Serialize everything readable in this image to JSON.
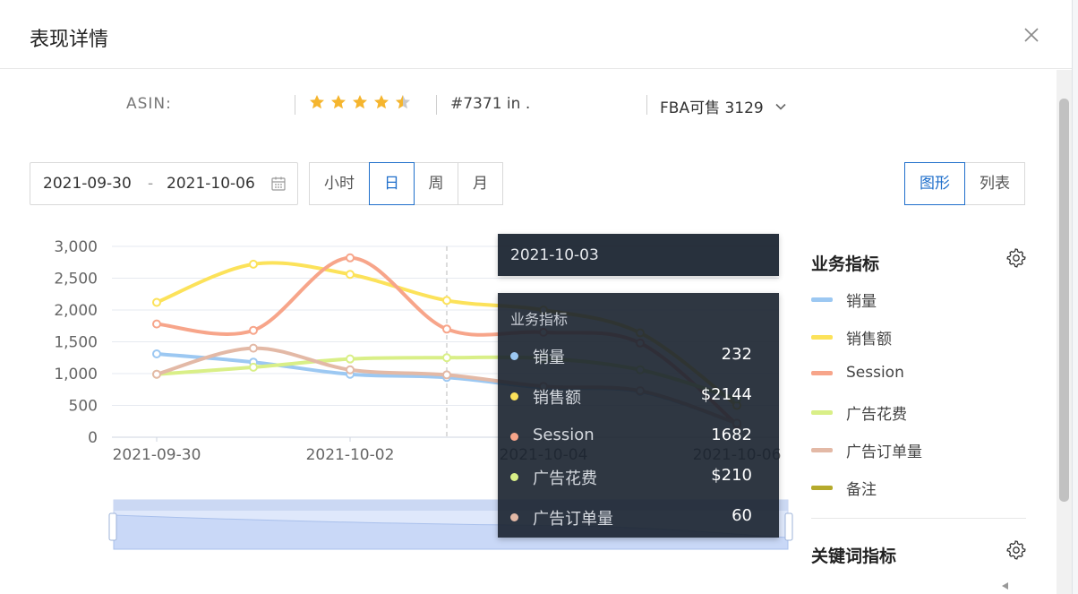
{
  "modal": {
    "title": "表现详情"
  },
  "info": {
    "asin_label": "ASIN:",
    "rating": 4.5,
    "rank_text": "#7371 in .",
    "fba_text": "FBA可售 3129"
  },
  "filters": {
    "start_date": "2021-09-30",
    "date_sep": "-",
    "end_date": "2021-10-06",
    "granularity": [
      "小时",
      "日",
      "周",
      "月"
    ],
    "granularity_selected": "日",
    "views": [
      "图形",
      "列表"
    ],
    "view_selected": "图形"
  },
  "legend": {
    "business_title": "业务指标",
    "keyword_title": "关键词指标",
    "items": [
      {
        "label": "销量",
        "color": "#9cc8f2"
      },
      {
        "label": "销售额",
        "color": "#fce25a"
      },
      {
        "label": "Session",
        "color": "#f7a58a"
      },
      {
        "label": "广告花费",
        "color": "#d9ef87"
      },
      {
        "label": "广告订单量",
        "color": "#e3b9a6"
      },
      {
        "label": "备注",
        "color": "#b5aa2c"
      }
    ]
  },
  "tooltip": {
    "date": "2021-10-03",
    "section": "业务指标",
    "rows": [
      {
        "name": "销量",
        "value": "232",
        "color": "#9cc8f2"
      },
      {
        "name": "销售额",
        "value": "$2144",
        "color": "#fce25a"
      },
      {
        "name": "Session",
        "value": "1682",
        "color": "#f7a58a"
      },
      {
        "name": "广告花费",
        "value": "$210",
        "color": "#d9ef87"
      },
      {
        "name": "广告订单量",
        "value": "60",
        "color": "#e3b9a6"
      }
    ]
  },
  "chart_data": {
    "type": "line",
    "x": [
      "2021-09-30",
      "2021-10-01",
      "2021-10-02",
      "2021-10-03",
      "2021-10-04",
      "2021-10-05",
      "2021-10-06"
    ],
    "x_tick_labels": [
      "2021-09-30",
      "2021-10-02",
      "2021-10-04",
      "2021-10-06"
    ],
    "y_ticks": [
      "0",
      "500",
      "1,000",
      "1,500",
      "2,000",
      "2,500",
      "3,000"
    ],
    "ylim": [
      0,
      3000
    ],
    "grid": true,
    "series": [
      {
        "name": "销量",
        "color": "#9cc8f2",
        "values": [
          1310,
          1180,
          990,
          940,
          780,
          720,
          220
        ]
      },
      {
        "name": "销售额",
        "color": "#fce25a",
        "values": [
          2120,
          2720,
          2560,
          2150,
          2000,
          1640,
          500
        ]
      },
      {
        "name": "Session",
        "color": "#f7a58a",
        "values": [
          1780,
          1680,
          2820,
          1700,
          1650,
          1480,
          200
        ]
      },
      {
        "name": "广告花费",
        "color": "#d9ef87",
        "values": [
          990,
          1100,
          1230,
          1250,
          1240,
          1060,
          600
        ]
      },
      {
        "name": "广告订单量",
        "color": "#e3b9a6",
        "values": [
          990,
          1400,
          1060,
          980,
          800,
          730,
          220
        ]
      }
    ],
    "hover_x": "2021-10-03"
  }
}
